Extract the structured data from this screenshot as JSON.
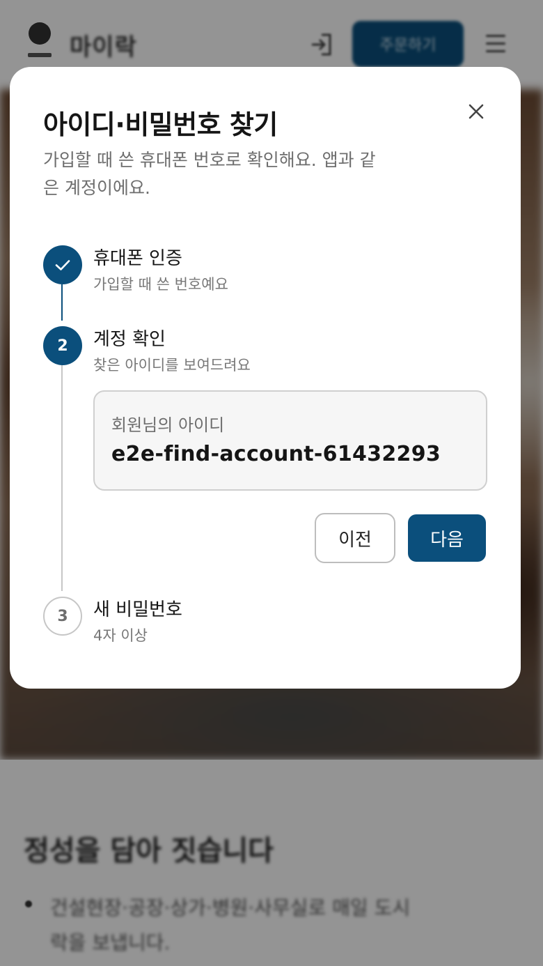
{
  "background": {
    "brand_name": "마이락",
    "order_button_label": "주문하기",
    "section_title": "정성을 담아 짓습니다",
    "section_bullet": "건설현장·공장·상가·병원·사무실로 매일 도시락을 보냅니다."
  },
  "modal": {
    "title": "아이디·비밀번호 찾기",
    "description": "가입할 때 쓴 휴대폰 번호로 확인해요. 앱과 같은 계정이에요.",
    "close_icon": "close-icon",
    "steps": [
      {
        "state": "done",
        "marker_icon": "check-icon",
        "title": "휴대폰 인증",
        "subtitle": "가입할 때 쓴 번호예요"
      },
      {
        "state": "active",
        "number": "2",
        "title": "계정 확인",
        "subtitle": "찾은 아이디를 보여드려요"
      },
      {
        "state": "pending",
        "number": "3",
        "title": "새 비밀번호",
        "subtitle": "4자 이상"
      }
    ],
    "account": {
      "label": "회원님의 아이디",
      "value": "e2e-find-account-61432293"
    },
    "prev_label": "이전",
    "next_label": "다음"
  },
  "colors": {
    "primary": "#0b4f7c",
    "overlay": "rgba(0,0,0,0.42)",
    "text_primary": "#151515",
    "text_secondary": "#6e6e6e",
    "pending_line": "#c6c6c6"
  }
}
